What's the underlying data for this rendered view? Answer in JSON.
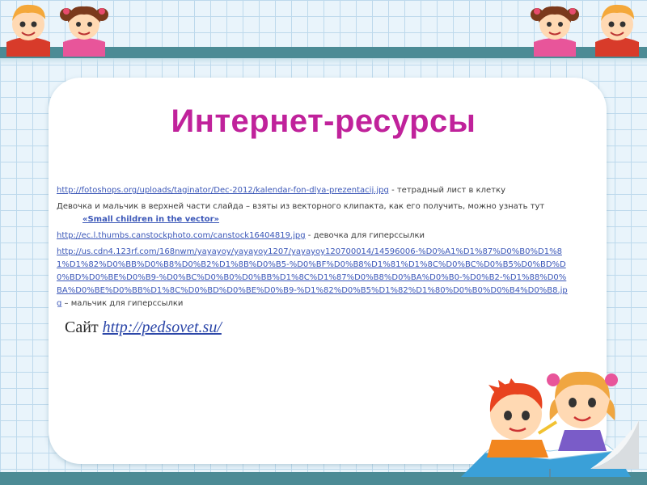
{
  "title": "Интернет-ресурсы",
  "resources": {
    "item1": {
      "link": "http://fotoshops.org/uploads/taginator/Dec-2012/kalendar-fon-dlya-prezentacij.jpg",
      "desc": " - тетрадный лист в клетку"
    },
    "item2": {
      "text": "Девочка и мальчик в верхней части слайда – взяты из векторного клипакта, как его получить, можно узнать тут",
      "link": "«Small children in the vector»"
    },
    "item3": {
      "link": "http://ec.l.thumbs.canstockphoto.com/canstock16404819.jpg",
      "desc": " - девочка для гиперссылки"
    },
    "item4": {
      "link": "http://us.cdn4.123rf.com/168nwm/yayayoy/yayayoy1207/yayayoy120700014/14596006-%D0%A1%D1%87%D0%B0%D1%81%D1%82%D0%BB%D0%B8%D0%B2%D1%8B%D0%B5-%D0%BF%D0%B8%D1%81%D1%8C%D0%BC%D0%B5%D0%BD%D0%BD%D0%BE%D0%B9-%D0%BC%D0%B0%D0%BB%D1%8C%D1%87%D0%B8%D0%BA%D0%B0-%D0%B2-%D1%88%D0%BA%D0%BE%D0%BB%D1%8C%D0%BD%D0%BE%D0%B9-%D1%82%D0%B5%D1%82%D1%80%D0%B0%D0%B4%D0%B8.jpg",
      "desc": " – мальчик для гиперссылки"
    }
  },
  "site": {
    "label": "Сайт ",
    "link": "http://pedsovet.su/"
  },
  "colors": {
    "title": "#c0229b",
    "band": "#4c8b95",
    "link": "#3b57b8"
  }
}
